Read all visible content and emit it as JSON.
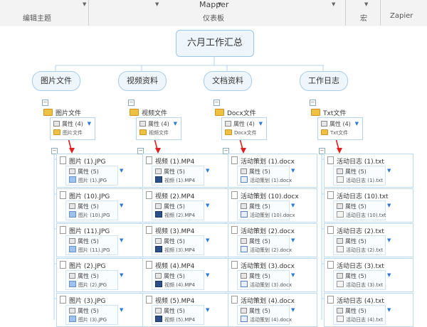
{
  "ribbon": {
    "groups": [
      "编辑主题",
      "仪表板",
      "宏",
      "Zapier"
    ],
    "title": "Mapper"
  },
  "map": {
    "root": "六月工作汇总",
    "branches": [
      {
        "label": "图片文件",
        "folder": "图片文件",
        "folder_prop": "属性 (4)",
        "folder_sub": "图片文件",
        "thumb": "image",
        "items": [
          {
            "name": "图片 (1).JPG",
            "prop": "属性 (5)",
            "sub": "图片 (1).JPG"
          },
          {
            "name": "图片 (10).JPG",
            "prop": "属性 (5)",
            "sub": "图片 (10).JPG"
          },
          {
            "name": "图片 (11).JPG",
            "prop": "属性 (5)",
            "sub": "图片 (11).JPG"
          },
          {
            "name": "图片 (2).JPG",
            "prop": "属性 (5)",
            "sub": "图片 (2).JPG"
          },
          {
            "name": "图片 (3).JPG",
            "prop": "属性 (5)",
            "sub": "图片 (3).JPG"
          }
        ]
      },
      {
        "label": "视频资料",
        "folder": "视频文件",
        "folder_prop": "属性 (4)",
        "folder_sub": "视频文件",
        "thumb": "video",
        "items": [
          {
            "name": "视频 (1).MP4",
            "prop": "属性 (5)",
            "sub": "视频 (1).MP4"
          },
          {
            "name": "视频 (2).MP4",
            "prop": "属性 (5)",
            "sub": "视频 (2).MP4"
          },
          {
            "name": "视频 (3).MP4",
            "prop": "属性 (5)",
            "sub": "视频 (3).MP4"
          },
          {
            "name": "视频 (4).MP4",
            "prop": "属性 (5)",
            "sub": "视频 (4).MP4"
          },
          {
            "name": "视频 (5).MP4",
            "prop": "属性 (5)",
            "sub": "视频 (5).MP4"
          }
        ]
      },
      {
        "label": "文档资料",
        "folder": "Docx文件",
        "folder_prop": "属性 (4)",
        "folder_sub": "Docx文件",
        "thumb": "doc",
        "items": [
          {
            "name": "活动策划 (1).docx",
            "prop": "属性 (5)",
            "sub": "活动策划 (1).docx"
          },
          {
            "name": "活动策划 (10).docx",
            "prop": "属性 (5)",
            "sub": "活动策划 (10).docx"
          },
          {
            "name": "活动策划 (2).docx",
            "prop": "属性 (5)",
            "sub": "活动策划 (2).docx"
          },
          {
            "name": "活动策划 (3).docx",
            "prop": "属性 (5)",
            "sub": "活动策划 (3).docx"
          },
          {
            "name": "活动策划 (4).docx",
            "prop": "属性 (5)",
            "sub": "活动策划 (4).docx"
          }
        ]
      },
      {
        "label": "工作日志",
        "folder": "Txt文件",
        "folder_prop": "属性 (4)",
        "folder_sub": "Txt文件",
        "thumb": "txt",
        "items": [
          {
            "name": "活动日志 (1).txt",
            "prop": "属性 (5)",
            "sub": "活动日志 (1).txt"
          },
          {
            "name": "活动日志 (10).txt",
            "prop": "属性 (5)",
            "sub": "活动日志 (10).txt"
          },
          {
            "name": "活动日志 (2).txt",
            "prop": "属性 (5)",
            "sub": "活动日志 (2).txt"
          },
          {
            "name": "活动日志 (3).txt",
            "prop": "属性 (5)",
            "sub": "活动日志 (3).txt"
          },
          {
            "name": "活动日志 (4).txt",
            "prop": "属性 (5)",
            "sub": "活动日志 (4).txt"
          }
        ]
      }
    ]
  },
  "colors": {
    "node_border": "#9cc6e6",
    "node_fill": "#eef6fc",
    "arrow": "#e02020",
    "caret": "#2d7ad6"
  }
}
